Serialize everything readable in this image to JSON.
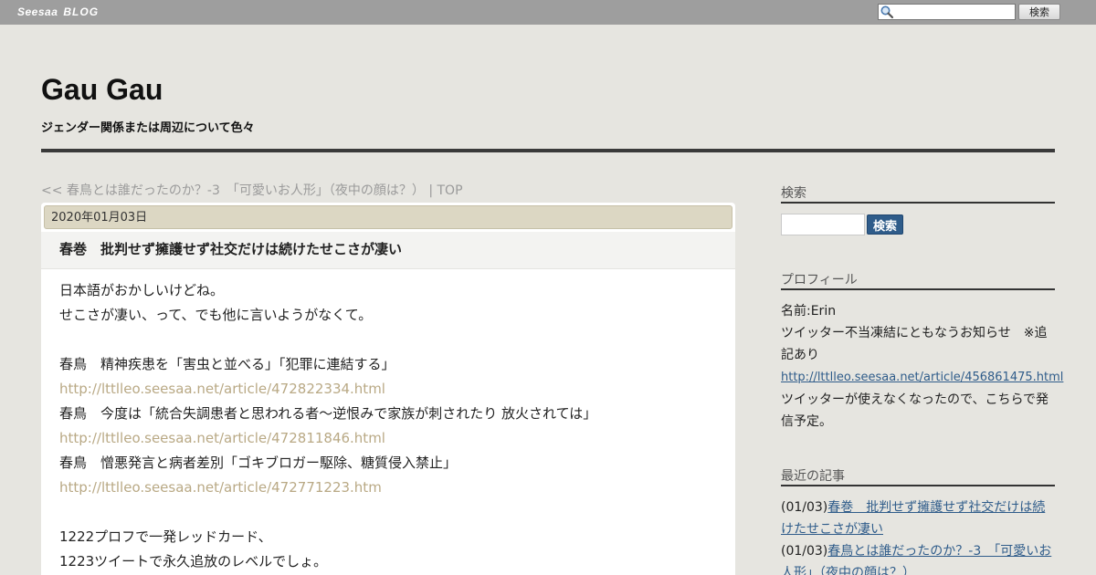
{
  "topbar": {
    "logo_text_1": "Seesaa",
    "logo_text_2": "BLOG",
    "search_placeholder": "",
    "search_button": "検索"
  },
  "header": {
    "title": "Gau Gau",
    "description": "ジェンダー関係または周辺について色々"
  },
  "nav": {
    "prev_link": "<< 春鳥とは誰だったのか？-3　「可愛いお人形」（夜中の顔は？）",
    "separator": " | ",
    "top_link": "TOP"
  },
  "article": {
    "date": "2020年01月03日",
    "title": "春巻　批判せず擁護せず社交だけは続けたせこさが凄い",
    "lines": [
      {
        "text": "日本語がおかしいけどね。",
        "link": false
      },
      {
        "text": "せこさが凄い、って、でも他に言いようがなくて。",
        "link": false
      },
      {
        "text": "",
        "link": false
      },
      {
        "text": "春鳥　精神疾患を「害虫と並べる」「犯罪に連結する」",
        "link": false
      },
      {
        "text": "http://lttlleo.seesaa.net/article/472822334.html",
        "link": true
      },
      {
        "text": "春鳥　今度は「統合失調患者と思われる者～逆恨みで家族が刺されたり 放火されては」",
        "link": false
      },
      {
        "text": "http://lttlleo.seesaa.net/article/472811846.html",
        "link": true
      },
      {
        "text": "春鳥　憎悪発言と病者差別「ゴキブロガー駆除、糖質侵入禁止」",
        "link": false
      },
      {
        "text": "http://lttlleo.seesaa.net/article/472771223.htm",
        "link": true
      },
      {
        "text": "",
        "link": false
      },
      {
        "text": "1222プロフで一発レッドカード、",
        "link": false
      },
      {
        "text": "1223ツイートで永久追放のレベルでしょ。",
        "link": false
      }
    ]
  },
  "sidebar": {
    "search_heading": "検索",
    "search_button": "検索",
    "profile_heading": "プロフィール",
    "profile_name": "名前:Erin",
    "profile_text_1": "ツイッター不当凍結にともなうお知らせ　※追記あり",
    "profile_link": "http://lttlleo.seesaa.net/article/456861475.html",
    "profile_text_2": "ツイッターが使えなくなったので、こちらで発信予定。",
    "recent_heading": "最近の記事",
    "recent": [
      {
        "date": "(01/03)",
        "title": "春巻　批判せず擁護せず社交だけは続けたせこさが凄い"
      },
      {
        "date": "(01/03)",
        "title": "春鳥とは誰だったのか？-3　「可愛いお人形」（夜中の顔は？）"
      }
    ]
  }
}
